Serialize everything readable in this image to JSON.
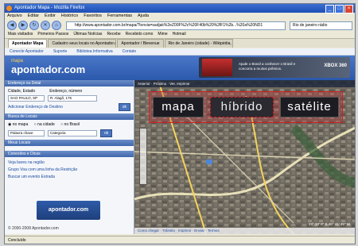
{
  "window": {
    "title": "Apontador Mapa - Mozilla Firefox"
  },
  "menu": [
    "Arquivo",
    "Editar",
    "Exibir",
    "Histórico",
    "Favoritos",
    "Ferramentas",
    "Ajuda"
  ],
  "nav": {
    "url": "http://www.apontador.com.br/mapa/?lonvia=sadjak%2eZ00F%2c%20F40b%20%2fF1%2b...%20a%20ND1",
    "search_placeholder": "Rio de janeiro rádio"
  },
  "bookmarks": [
    "Mais visitados",
    "Primeiros Passos",
    "Últimas Notícias",
    "Recebe",
    "Recebido como",
    "Mime",
    "Hotmail"
  ],
  "tabs": [
    {
      "label": "Apontador Mapa",
      "active": true
    },
    {
      "label": "Cadastro seus locais no Apontador.com",
      "active": false
    },
    {
      "label": "Apontador / Bievenue",
      "active": false
    },
    {
      "label": "Rio de Janeiro (cidade) - Wikipédia, a...",
      "active": false
    }
  ],
  "site": {
    "nav": [
      "Conecte Apontador",
      "Suporte",
      "Bibliotea Informativa",
      "Contato"
    ],
    "logo": "apontador.com",
    "logo_tag": "mapa",
    "ad": {
      "text": "Ajude o Brasil a conhecer o Brasil e concorra a muitos prêmios.",
      "brand": "XBOX 360"
    }
  },
  "sidebar": {
    "address_section": "Endereço ou Detal",
    "address_label": "Cidade, Estado",
    "address_label2": "Endereço, número",
    "city_value": "SAO PAULO, SP",
    "street_value": "R. Alagõ, 176",
    "add_link": "Adicionar Endereço de Destino",
    "locals_section": "Busca de Locais",
    "radio_options": [
      "no mapa",
      "na cidade",
      "no Brasil"
    ],
    "keyword_label": "Palavra chave",
    "category_label": "Categoria",
    "ok_label": "ok",
    "myplaces_section": "Meus Locais",
    "tips_section": "Conexões e Dicas",
    "links": [
      "Veja bares na região",
      "Grupo Voa com uma linha da Restrição",
      "Buscar um evento Estrada"
    ],
    "copyright": "© 2000-2008 Apontador.com"
  },
  "map": {
    "toolbar": "Anterior · Próximo · Ver. Imprimir",
    "modes": [
      {
        "label": "mapa",
        "selected": false
      },
      {
        "label": "híbrido",
        "selected": true
      },
      {
        "label": "satélite",
        "selected": false
      }
    ],
    "scale": "50 m",
    "footer": "Como chegar · Trânsito · Imprimir · Enviar · Termos",
    "coords": "23° 33' 8\" S  46° 41' 45\" W"
  },
  "status": "Concluído"
}
